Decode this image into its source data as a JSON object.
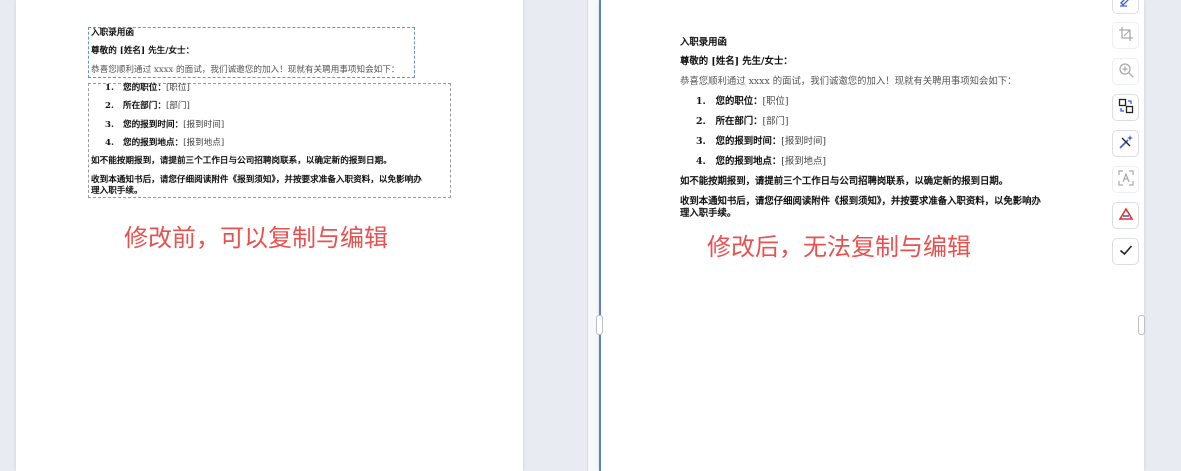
{
  "document": {
    "title": "入职录用函",
    "greeting": "尊敬的 [姓名] 先生/女士：",
    "intro": "恭喜您顺利通过 xxxx 的面试，我们诚邀您的加入！现就有关聘用事项知会如下：",
    "items": [
      {
        "num": "1.",
        "label": "您的职位：",
        "value": "[职位]"
      },
      {
        "num": "2.",
        "label": "所在部门：",
        "value": "[部门]"
      },
      {
        "num": "3.",
        "label": "您的报到时间：",
        "value": "[报到时间]"
      },
      {
        "num": "4.",
        "label": "您的报到地点：",
        "value": "[报到地点]"
      }
    ],
    "notice": "如不能按期报到，请提前三个工作日与公司招聘岗联系，以确定新的报到日期。",
    "closing_line1": "收到本通知书后，请您仔细阅读附件《报到须知》，并按要求准备入职资料，以免影响办",
    "closing_line2": "理入职手续。"
  },
  "captions": {
    "before": "修改前，可以复制与编辑",
    "after": "修改后，无法复制与编辑"
  },
  "toolbar": {
    "icons": [
      "sign-pen-icon",
      "crop-icon",
      "zoom-in-icon",
      "convert-icon",
      "ai-magic-icon",
      "ocr-text-icon",
      "acrobat-icon",
      "check-icon"
    ]
  },
  "colors": {
    "caption": "#e8514f",
    "selection_border": "#6a8fd0",
    "active_page_border": "#5a7fd6"
  }
}
